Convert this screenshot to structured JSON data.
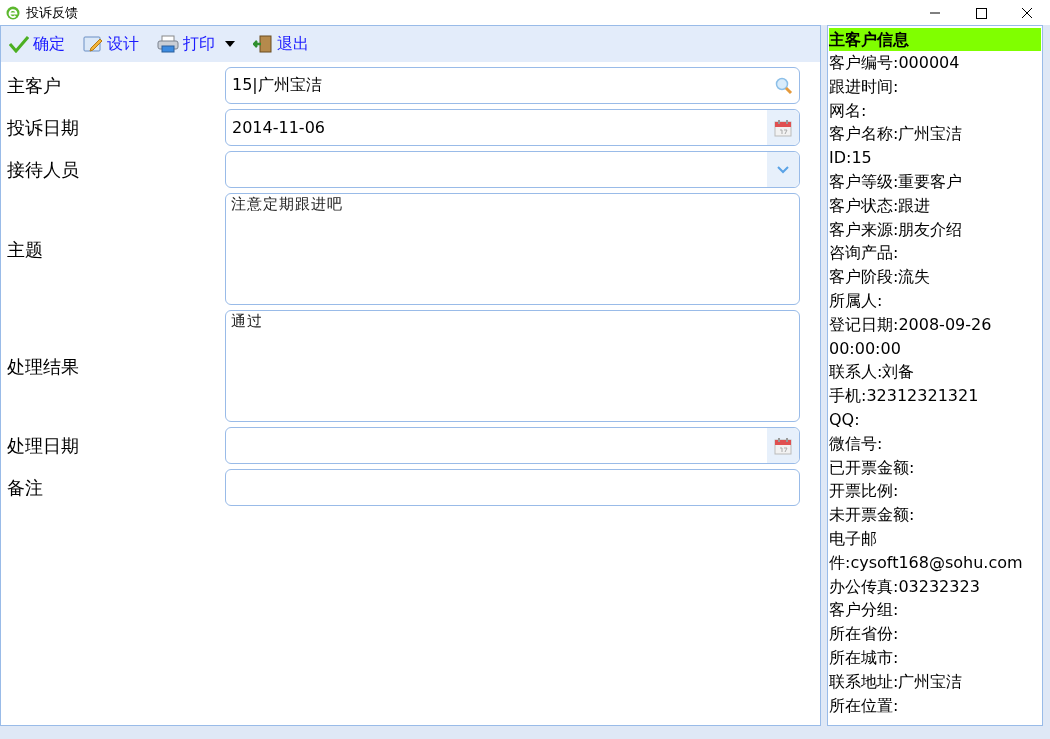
{
  "window": {
    "title": "投诉反馈"
  },
  "toolbar": [
    {
      "label": "确定",
      "kind": "ok"
    },
    {
      "label": "设计",
      "kind": "design"
    },
    {
      "label": "打印",
      "kind": "print"
    },
    {
      "label": "退出",
      "kind": "exit"
    }
  ],
  "form": [
    {
      "label": "主客户",
      "kind": "search",
      "value": "15|广州宝洁"
    },
    {
      "label": "投诉日期",
      "kind": "date",
      "value": "2014-11-06"
    },
    {
      "label": "接待人员",
      "kind": "select"
    },
    {
      "label": "主题",
      "kind": "textarea",
      "value": "注意定期跟进吧"
    },
    {
      "label": "处理结果",
      "kind": "textarea",
      "value": "通过"
    },
    {
      "label": "处理日期",
      "kind": "date"
    },
    {
      "label": "备注",
      "kind": "text"
    }
  ],
  "info_panel": {
    "title": "主客户信息",
    "lines": [
      "客户编号:000004",
      "跟进时间:",
      "网名:",
      "客户名称:广州宝洁",
      "ID:15",
      "客户等级:重要客户",
      "客户状态:跟进",
      "客户来源:朋友介绍",
      "咨询产品:",
      "客户阶段:流失",
      "所属人:",
      "登记日期:2008-09-26 00:00:00",
      "联系人:刘备",
      "手机:32312321321",
      "QQ:",
      "微信号:",
      "已开票金额:",
      "开票比例:",
      "未开票金额:",
      "电子邮件:cysoft168@sohu.com",
      "办公传真:03232323",
      "客户分组:",
      "所在省份:",
      "所在城市:",
      "联系地址:广州宝洁",
      "所在位置:"
    ]
  }
}
